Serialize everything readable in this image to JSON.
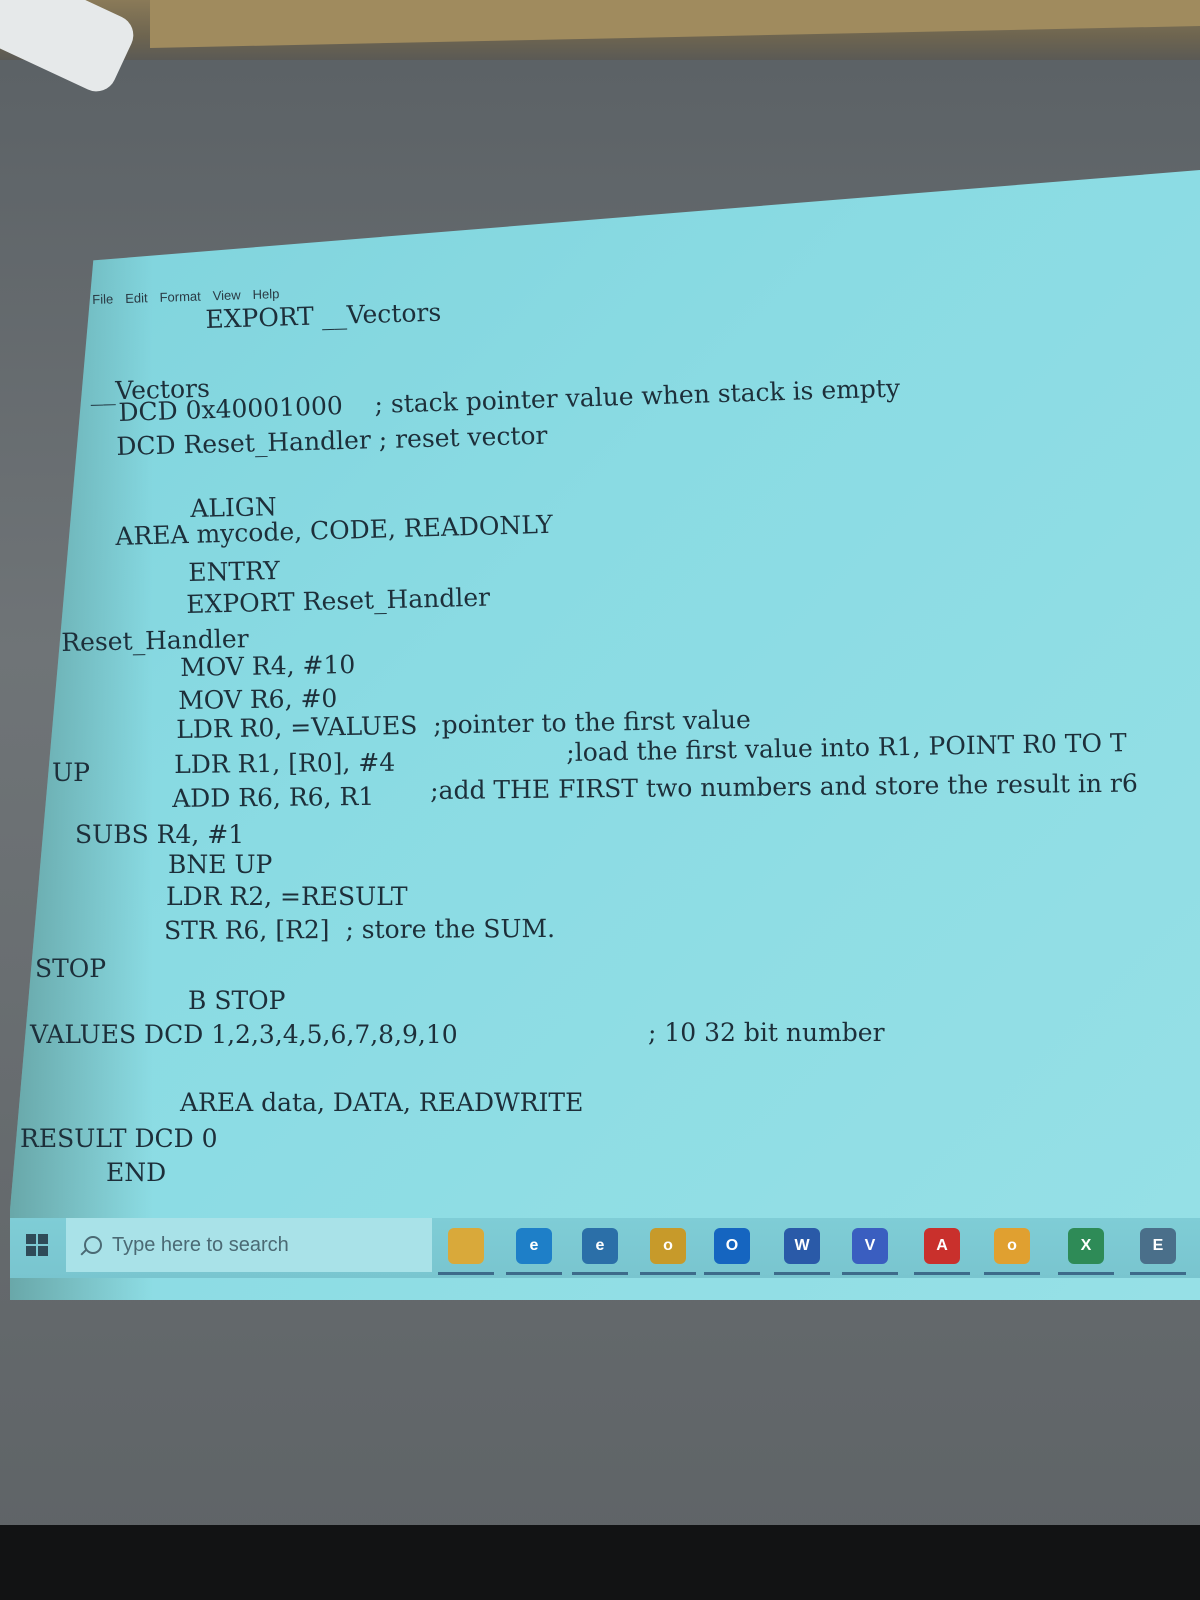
{
  "menu": {
    "items": [
      "File",
      "Edit",
      "Format",
      "View",
      "Help"
    ]
  },
  "code": {
    "lines": [
      "EXPORT __Vectors",
      "__Vectors",
      "DCD 0x40001000    ; stack pointer value when stack is empty",
      "DCD Reset_Handler ; reset vector",
      "ALIGN",
      "AREA mycode, CODE, READONLY",
      "ENTRY",
      "EXPORT Reset_Handler",
      "Reset_Handler",
      "MOV R4, #10",
      "MOV R6, #0",
      "LDR R0, =VALUES  ;pointer to the first value",
      "UP",
      "LDR R1, [R0], #4",
      ";load the first value into R1, POINT R0 TO T",
      "ADD R6, R6, R1",
      ";add THE FIRST two numbers and store the result in r6",
      "SUBS R4, #1",
      "BNE UP",
      "LDR R2, =RESULT",
      "STR R6, [R2]  ; store the SUM.",
      "STOP",
      "B STOP",
      "VALUES DCD 1,2,3,4,5,6,7,8,9,10",
      "; 10 32 bit number",
      "AREA data, DATA, READWRITE",
      "RESULT DCD 0",
      "END"
    ]
  },
  "taskbar": {
    "search_placeholder": "Type here to search",
    "icons": [
      {
        "name": "file-explorer-icon",
        "color": "#d9a93a",
        "glyph": ""
      },
      {
        "name": "edge-icon",
        "color": "#1e7fc8",
        "glyph": "e"
      },
      {
        "name": "ie-icon",
        "color": "#2b6fa8",
        "glyph": "e"
      },
      {
        "name": "search-app-icon",
        "color": "#c79a2a",
        "glyph": "o"
      },
      {
        "name": "outlook-icon",
        "color": "#1565c0",
        "glyph": "O"
      },
      {
        "name": "word-icon",
        "color": "#2a5aa8",
        "glyph": "W"
      },
      {
        "name": "visio-icon",
        "color": "#3a5ec0",
        "glyph": "V"
      },
      {
        "name": "acrobat-icon",
        "color": "#c9302c",
        "glyph": "A"
      },
      {
        "name": "chrome-icon",
        "color": "#e0a030",
        "glyph": "o"
      },
      {
        "name": "excel-icon",
        "color": "#2e8b57",
        "glyph": "X"
      },
      {
        "name": "app-icon",
        "color": "#4a6f8a",
        "glyph": "E"
      }
    ]
  },
  "colors": {
    "projection": "#8adbe3",
    "code_text": "#1d2f3a",
    "wall": "#6f7477"
  }
}
